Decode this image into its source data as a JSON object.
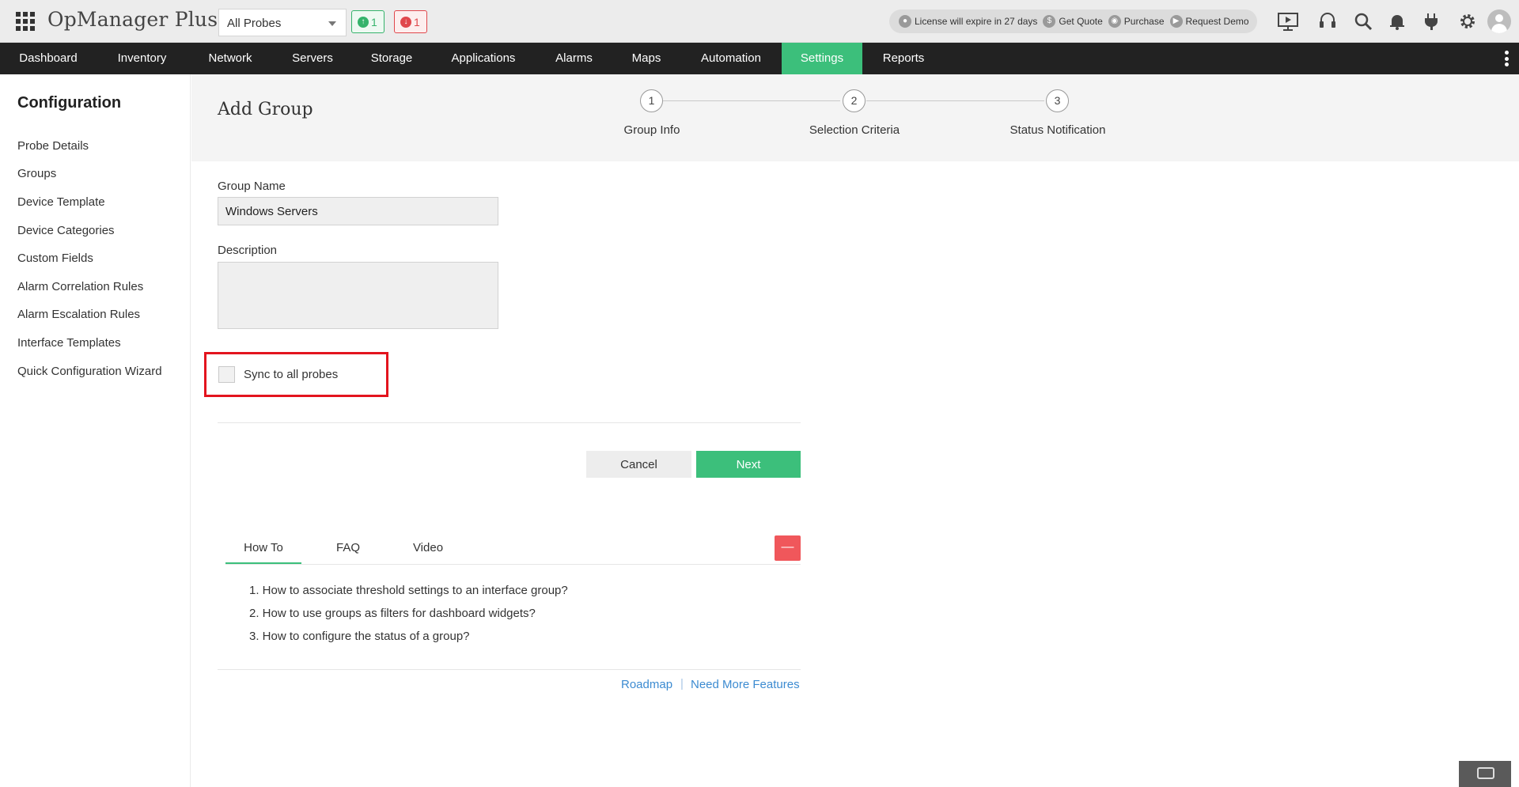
{
  "app": {
    "title": "OpManager Plus",
    "probe_select": "All Probes",
    "up_count": "1",
    "down_count": "1"
  },
  "license_bar": {
    "expire_text": "License will expire in 27 days",
    "get_quote": "Get Quote",
    "purchase": "Purchase",
    "request_demo": "Request Demo"
  },
  "top_icons": [
    "presentation-icon",
    "headset-icon",
    "search-icon",
    "bell-icon",
    "plug-icon",
    "gear-icon",
    "avatar"
  ],
  "nav": {
    "items": [
      {
        "label": "Dashboard"
      },
      {
        "label": "Inventory"
      },
      {
        "label": "Network"
      },
      {
        "label": "Servers"
      },
      {
        "label": "Storage"
      },
      {
        "label": "Applications"
      },
      {
        "label": "Alarms"
      },
      {
        "label": "Maps"
      },
      {
        "label": "Automation"
      },
      {
        "label": "Settings"
      },
      {
        "label": "Reports"
      }
    ],
    "active": "Settings"
  },
  "sidebar": {
    "title": "Configuration",
    "items": [
      {
        "label": "Probe Details"
      },
      {
        "label": "Groups"
      },
      {
        "label": "Device Template"
      },
      {
        "label": "Device Categories"
      },
      {
        "label": "Custom Fields"
      },
      {
        "label": "Alarm Correlation Rules"
      },
      {
        "label": "Alarm Escalation Rules"
      },
      {
        "label": "Interface Templates"
      },
      {
        "label": "Quick Configuration Wizard"
      }
    ]
  },
  "page": {
    "title": "Add Group",
    "steps": [
      {
        "number": "1",
        "label": "Group Info"
      },
      {
        "number": "2",
        "label": "Selection Criteria"
      },
      {
        "number": "3",
        "label": "Status Notification"
      }
    ]
  },
  "form": {
    "group_name_label": "Group Name",
    "group_name_value": "Windows Servers",
    "description_label": "Description",
    "description_value": "",
    "sync_label": "Sync to all probes",
    "sync_checked": false,
    "cancel_label": "Cancel",
    "next_label": "Next"
  },
  "help": {
    "tabs": [
      {
        "label": "How To"
      },
      {
        "label": "FAQ"
      },
      {
        "label": "Video"
      }
    ],
    "active_tab": "How To",
    "collapse_label": "—",
    "items": [
      "1. How to associate threshold settings to an interface group?",
      "2. How to use groups as filters for dashboard widgets?",
      "3. How to configure the status of a group?"
    ]
  },
  "footer": {
    "roadmap": "Roadmap",
    "separator": "|",
    "need_more": "Need More Features"
  },
  "colors": {
    "accent_green": "#3cbf7b",
    "nav_bg": "#222222",
    "alert_red": "#e0474c",
    "highlight_red": "#e3141e",
    "link_blue": "#3c8bd1"
  }
}
